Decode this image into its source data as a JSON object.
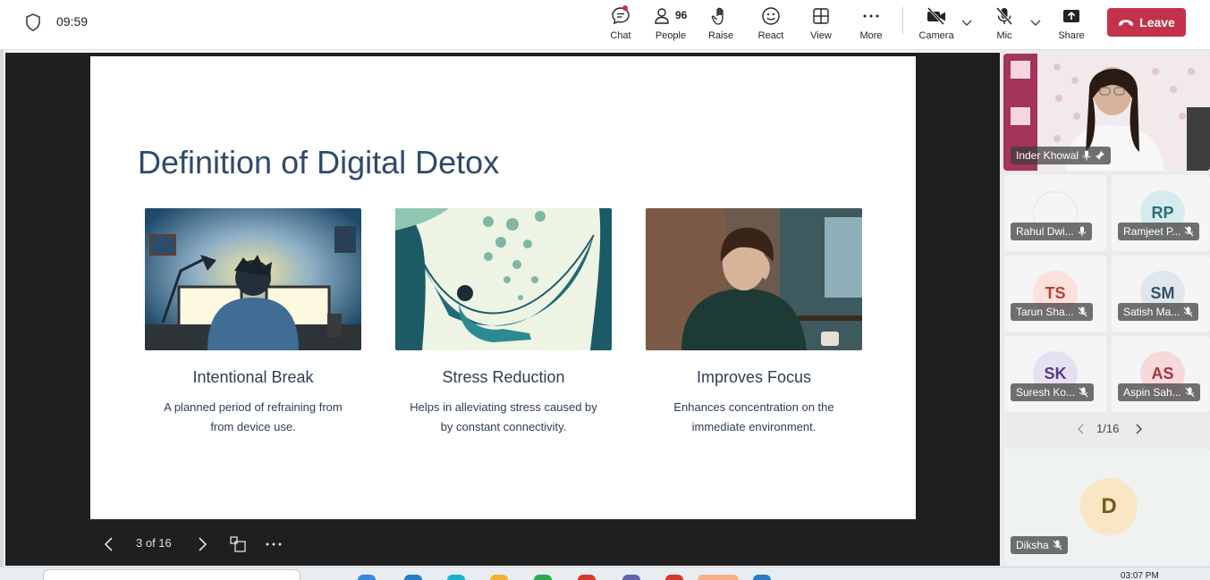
{
  "header": {
    "timer": "09:59",
    "controls": {
      "chat": "Chat",
      "people": "People",
      "people_count": "96",
      "raise": "Raise",
      "react": "React",
      "view": "View",
      "more": "More",
      "camera": "Camera",
      "mic": "Mic",
      "share": "Share"
    },
    "leave_label": "Leave",
    "colors": {
      "leave": "#c4314b"
    }
  },
  "slide": {
    "title": "Definition of Digital Detox",
    "cards": [
      {
        "title": "Intentional Break",
        "desc_line1": "A planned period of refraining from",
        "desc_line2": "from device use."
      },
      {
        "title": "Stress Reduction",
        "desc_line1": "Helps in alleviating stress caused by",
        "desc_line2": "by constant connectivity."
      },
      {
        "title": "Improves Focus",
        "desc_line1": "Enhances concentration on the",
        "desc_line2": "immediate environment."
      }
    ]
  },
  "slide_nav": {
    "page_indicator": "3 of 16"
  },
  "participants": {
    "spotlight": {
      "name": "Inder Khowal"
    },
    "tiles": [
      {
        "initials": "",
        "name": "Rahul Dwi..."
      },
      {
        "initials": "RP",
        "name": "Ramjeet P..."
      },
      {
        "initials": "TS",
        "name": "Tarun Sha..."
      },
      {
        "initials": "SM",
        "name": "Satish Ma..."
      },
      {
        "initials": "SK",
        "name": "Suresh Ko..."
      },
      {
        "initials": "AS",
        "name": "Aspin Sah..."
      }
    ],
    "pager": "1/16",
    "bottom": {
      "initials": "D",
      "name": "Diksha"
    }
  },
  "taskbar": {
    "clock": "03:07 PM"
  }
}
